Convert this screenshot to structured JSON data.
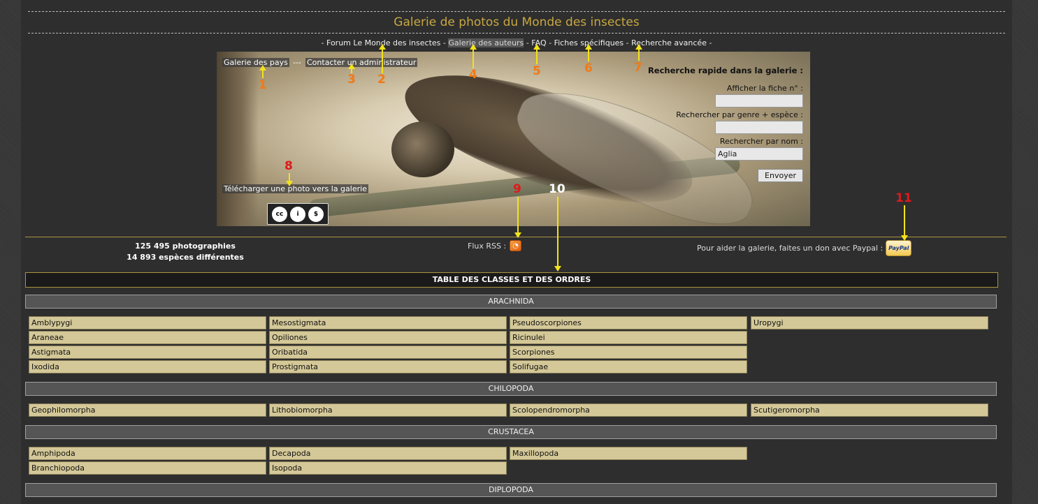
{
  "header": {
    "title": "Galerie de photos du Monde des insectes"
  },
  "nav": {
    "forum": "Forum Le Monde des insectes",
    "auteurs": "Galerie des auteurs",
    "faq": "FAQ",
    "fiches": "Fiches spécifiques",
    "recherche": "Recherche avancée",
    "sep": "-"
  },
  "banner": {
    "pays": "Galerie des pays",
    "sep": "---",
    "contact": "Contacter un administrateur",
    "upload": "Télécharger une photo vers la galerie",
    "cc_labels": [
      "cc",
      "i",
      "$",
      "BY",
      "NC"
    ]
  },
  "quick_search": {
    "title": "Recherche rapide dans la galerie :",
    "fiche_label": "Afficher la fiche n° :",
    "fiche_value": "",
    "genre_label": "Rechercher par genre + espèce :",
    "genre_value": "",
    "nom_label": "Rechercher par nom :",
    "nom_value": "Aglia",
    "submit": "Envoyer"
  },
  "stats": {
    "photos": "125 495 photographies",
    "species": "14 893 espèces différentes"
  },
  "rss": {
    "label": "Flux RSS :"
  },
  "donate": {
    "label": "Pour aider la galerie, faites un don avec Paypal :",
    "button": "PayPal"
  },
  "table": {
    "title": "TABLE DES CLASSES ET DES ORDRES",
    "sections": [
      {
        "name": "ARACHNIDA",
        "columns": [
          [
            "Amblypygi",
            "Araneae",
            "Astigmata",
            "Ixodida"
          ],
          [
            "Mesostigmata",
            "Opiliones",
            "Oribatida",
            "Prostigmata"
          ],
          [
            "Pseudoscorpiones",
            "Ricinulei",
            "Scorpiones",
            "Solifugae"
          ],
          [
            "Uropygi"
          ]
        ]
      },
      {
        "name": "CHILOPODA",
        "columns": [
          [
            "Geophilomorpha"
          ],
          [
            "Lithobiomorpha"
          ],
          [
            "Scolopendromorpha"
          ],
          [
            "Scutigeromorpha"
          ]
        ]
      },
      {
        "name": "CRUSTACEA",
        "columns": [
          [
            "Amphipoda",
            "Branchiopoda"
          ],
          [
            "Decapoda",
            "Isopoda"
          ],
          [
            "Maxillopoda"
          ],
          []
        ]
      },
      {
        "name": "DIPLOPODA",
        "columns": [
          [],
          [],
          [],
          []
        ]
      }
    ]
  },
  "annotations": {
    "a1": "1",
    "a2": "2",
    "a3": "3",
    "a4": "4",
    "a5": "5",
    "a6": "6",
    "a7": "7",
    "a8": "8",
    "a9": "9",
    "a10": "10",
    "a11": "11"
  },
  "colors": {
    "title": "#c8a840",
    "cell_bg": "#d4c898",
    "annotation_orange": "#f07a18",
    "annotation_red": "#e01818",
    "arrow": "#f2e21a"
  }
}
